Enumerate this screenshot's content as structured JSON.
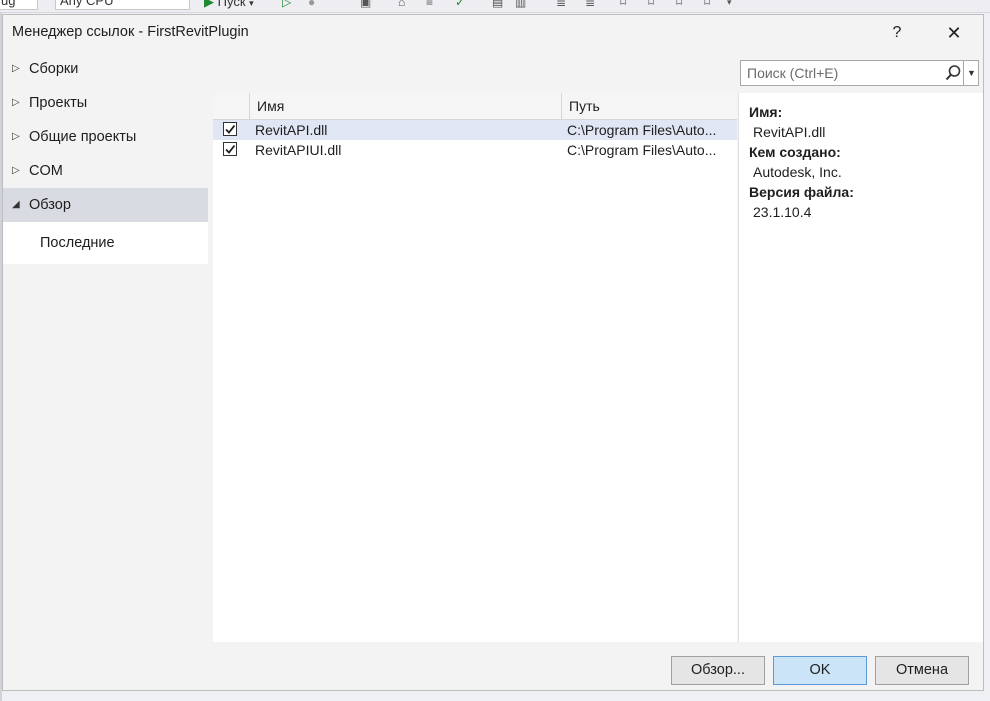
{
  "ide": {
    "config_value": "ug",
    "platform_value": "Any CPU",
    "run_label": "Пуск"
  },
  "dialog": {
    "title": "Менеджер ссылок - FirstRevitPlugin",
    "help_label": "?",
    "close_label": "✕"
  },
  "nav": {
    "items": [
      {
        "label": "Сборки",
        "expanded": false
      },
      {
        "label": "Проекты",
        "expanded": false
      },
      {
        "label": "Общие проекты",
        "expanded": false
      },
      {
        "label": "COM",
        "expanded": false
      },
      {
        "label": "Обзор",
        "expanded": true
      }
    ],
    "sub_item": "Последние"
  },
  "search": {
    "placeholder": "Поиск (Ctrl+E)",
    "value": ""
  },
  "grid": {
    "columns": {
      "name": "Имя",
      "path": "Путь"
    },
    "rows": [
      {
        "checked": true,
        "name": "RevitAPI.dll",
        "path": "C:\\Program Files\\Auto..."
      },
      {
        "checked": true,
        "name": "RevitAPIUI.dll",
        "path": "C:\\Program Files\\Auto..."
      }
    ]
  },
  "details": {
    "name_label": "Имя:",
    "name_value": "RevitAPI.dll",
    "created_by_label": "Кем создано:",
    "created_by_value": "Autodesk, Inc.",
    "version_label": "Версия файла:",
    "version_value": "23.1.10.4"
  },
  "buttons": {
    "browse": "Обзор...",
    "ok": "OK",
    "cancel": "Отмена"
  },
  "colors": {
    "accent": "#5a9ad8",
    "selection": "#e1e6f4",
    "nav_selected": "#d8dbe1"
  }
}
